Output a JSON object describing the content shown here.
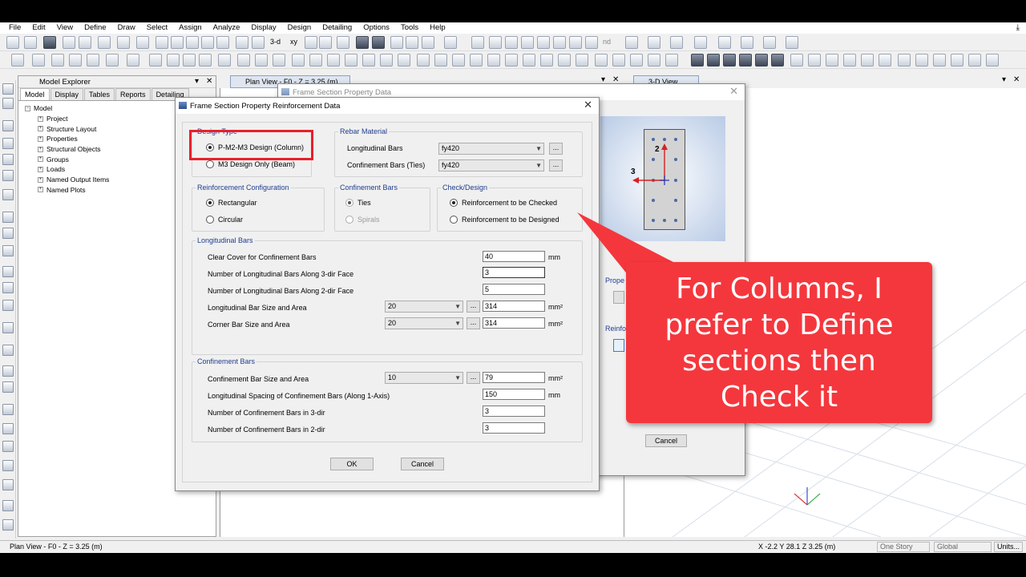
{
  "menu": [
    "File",
    "Edit",
    "View",
    "Define",
    "Draw",
    "Select",
    "Assign",
    "Analyze",
    "Display",
    "Design",
    "Detailing",
    "Options",
    "Tools",
    "Help"
  ],
  "toolbar": {
    "btn_3d": "3-d",
    "btn_xy": "xy",
    "btn_nd": "nd"
  },
  "explorer": {
    "title": "Model Explorer",
    "pin": "▾",
    "close": "✕",
    "tabs": [
      "Model",
      "Display",
      "Tables",
      "Reports",
      "Detailing"
    ],
    "root": "Model",
    "root_toggle": "−",
    "child_toggle": "+",
    "items": [
      "Project",
      "Structure Layout",
      "Properties",
      "Structural Objects",
      "Groups",
      "Loads",
      "Named Output Items",
      "Named Plots"
    ]
  },
  "views": {
    "plan_title": "Plan View - F0 - Z = 3.25 (m)",
    "view3d_title": "3-D View",
    "pin": "▾",
    "close": "✕"
  },
  "statusbar": {
    "left": "Plan View - F0 - Z = 3.25 (m)",
    "coords": "X -2.2  Y 28.1  Z 3.25 (m)",
    "story": "One Story",
    "csys": "Global",
    "units": "Units..."
  },
  "back_dialog": {
    "title": "Frame Section Property Data",
    "close": "✕",
    "section_dims": {
      "label_2": "2",
      "label_3": "3"
    },
    "prop_label": "Prope",
    "reinf_label": "Reinfo",
    "cancel": "Cancel"
  },
  "dialog": {
    "title": "Frame Section Property Reinforcement Data",
    "close": "✕",
    "design_type": {
      "label": "Design Type",
      "options": [
        {
          "label": "P-M2-M3 Design  (Column)",
          "checked": true
        },
        {
          "label": "M3 Design Only  (Beam)",
          "checked": false
        }
      ]
    },
    "rebar_material": {
      "label": "Rebar Material",
      "longitudinal_label": "Longitudinal Bars",
      "longitudinal_value": "fy420",
      "confinement_label": "Confinement Bars (Ties)",
      "confinement_value": "fy420",
      "dots": "..."
    },
    "reinf_config": {
      "label": "Reinforcement Configuration",
      "options": [
        {
          "label": "Rectangular",
          "checked": true
        },
        {
          "label": "Circular",
          "checked": false
        }
      ]
    },
    "confinement_type": {
      "label": "Confinement Bars",
      "options": [
        {
          "label": "Ties",
          "checked": true
        },
        {
          "label": "Spirals",
          "checked": false
        }
      ]
    },
    "check_design": {
      "label": "Check/Design",
      "options": [
        {
          "label": "Reinforcement to be Checked",
          "checked": true
        },
        {
          "label": "Reinforcement to be Designed",
          "checked": false
        }
      ]
    },
    "longitudinal": {
      "label": "Longitudinal Bars",
      "clear_cover_label": "Clear Cover for Confinement Bars",
      "clear_cover_value": "40",
      "clear_cover_unit": "mm",
      "n3_label": "Number of Longitudinal Bars Along 3-dir Face",
      "n3_value": "3",
      "n2_label": "Number of Longitudinal Bars Along 2-dir Face",
      "n2_value": "5",
      "bar_size_label": "Longitudinal Bar Size and Area",
      "bar_size": "20",
      "bar_area": "314",
      "area_unit": "mm²",
      "corner_label": "Corner Bar Size and Area",
      "corner_size": "20",
      "corner_area": "314",
      "dots": "..."
    },
    "confinement": {
      "label": "Confinement Bars",
      "size_label": "Confinement Bar Size and Area",
      "size": "10",
      "area": "79",
      "area_unit": "mm²",
      "spacing_label": "Longitudinal Spacing of Confinement Bars  (Along 1-Axis)",
      "spacing": "150",
      "spacing_unit": "mm",
      "n3_label": "Number of Confinement Bars in 3-dir",
      "n3": "3",
      "n2_label": "Number of Confinement Bars in 2-dir",
      "n2": "3",
      "dots": "..."
    },
    "ok": "OK",
    "cancel": "Cancel"
  },
  "callout": {
    "text": "For Columns, I\nprefer to Define\nsections then\nCheck it",
    "color": "#f4373d"
  },
  "colors": {
    "highlight": "#e8202a",
    "group_label": "#1f3d8f"
  }
}
